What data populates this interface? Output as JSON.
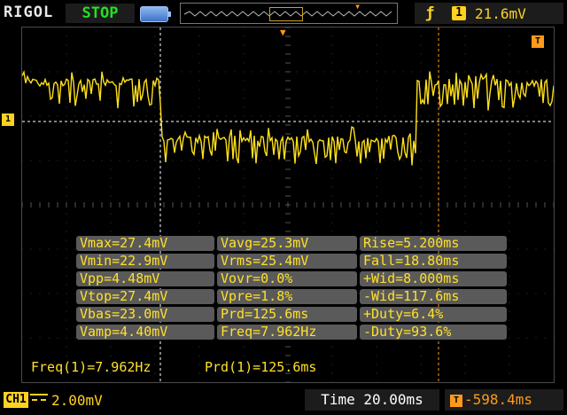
{
  "header": {
    "brand": "RIGOL",
    "run_status": "STOP",
    "trigger_edge_symbol": "ƒ",
    "trigger_channel": "1",
    "trigger_level": "21.6mV"
  },
  "markers": {
    "trigger_pos": "T",
    "trigger_badge": "T",
    "channel_marker": "1"
  },
  "measurements": [
    [
      "Vmax=27.4mV",
      "Vavg=25.3mV",
      "Rise=5.200ms"
    ],
    [
      "Vmin=22.9mV",
      "Vrms=25.4mV",
      "Fall=18.80ms"
    ],
    [
      "Vpp=4.48mV",
      "Vovr=0.0%",
      "+Wid=8.000ms"
    ],
    [
      "Vtop=27.4mV",
      "Vpre=1.8%",
      "-Wid=117.6ms"
    ],
    [
      "Vbas=23.0mV",
      "Prd=125.6ms",
      "+Duty=6.4%"
    ],
    [
      "Vamp=4.40mV",
      "Freq=7.962Hz",
      "-Duty=93.6%"
    ]
  ],
  "counter": {
    "freq": "Freq(1)=7.962Hz",
    "prd": "Prd(1)=125.6ms"
  },
  "footer": {
    "channel_label": "CH1",
    "vertical_scale": "2.00mV",
    "timebase": "Time 20.00ms",
    "trigger_offset_icon": "T",
    "trigger_offset": "-598.4ms"
  },
  "colors": {
    "trace": "#ffe01a",
    "accent": "#ff9a1a",
    "run_status": "#22e022",
    "grid": "#3c3c3c"
  }
}
